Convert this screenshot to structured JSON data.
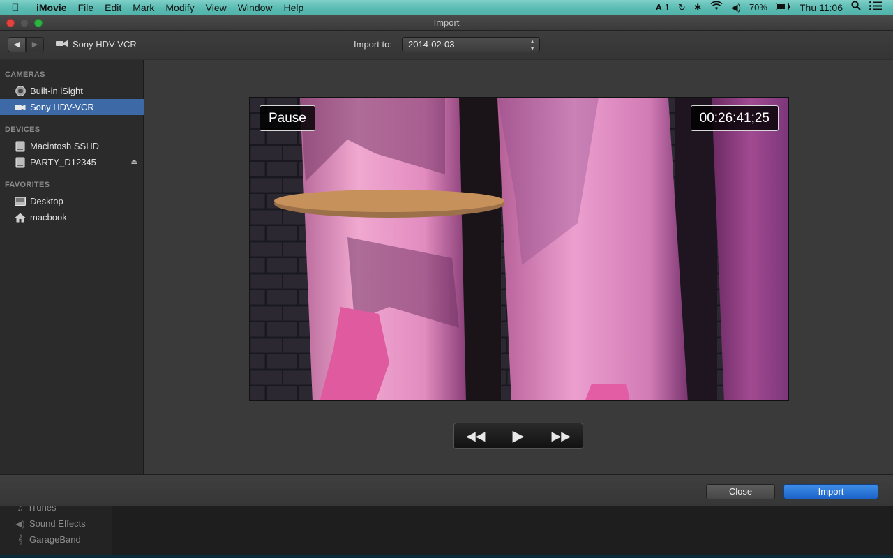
{
  "menubar": {
    "app_name": "iMovie",
    "menus": [
      "File",
      "Edit",
      "Mark",
      "Modify",
      "View",
      "Window",
      "Help"
    ],
    "status": {
      "adobe_badge": "1",
      "battery": "70%",
      "clock": "Thu 11:06"
    }
  },
  "window": {
    "title": "Import"
  },
  "toolbar": {
    "device_label": "Sony HDV-VCR",
    "import_to_label": "Import to:",
    "import_to_value": "2014-02-03"
  },
  "sidebar": {
    "sections": [
      {
        "title": "CAMERAS",
        "items": [
          {
            "label": "Built-in iSight",
            "icon": "camera-round-icon",
            "selected": false
          },
          {
            "label": "Sony HDV-VCR",
            "icon": "video-camera-icon",
            "selected": true
          }
        ]
      },
      {
        "title": "DEVICES",
        "items": [
          {
            "label": "Macintosh SSHD",
            "icon": "hard-drive-icon",
            "selected": false
          },
          {
            "label": "PARTY_D12345",
            "icon": "hard-drive-icon",
            "selected": false,
            "eject": true
          }
        ]
      },
      {
        "title": "FAVORITES",
        "items": [
          {
            "label": "Desktop",
            "icon": "desktop-icon",
            "selected": false
          },
          {
            "label": "macbook",
            "icon": "home-icon",
            "selected": false
          }
        ]
      }
    ]
  },
  "viewer": {
    "status_overlay": "Pause",
    "timecode": "00:26:41;25"
  },
  "transport": {
    "rewind_icon": "rewind-icon",
    "play_icon": "play-icon",
    "fast_forward_icon": "fast-forward-icon"
  },
  "footer": {
    "close_label": "Close",
    "import_label": "Import"
  },
  "background_library": {
    "items": [
      {
        "label": "iTunes",
        "icon": "music-note-icon"
      },
      {
        "label": "Sound Effects",
        "icon": "speaker-icon"
      },
      {
        "label": "GarageBand",
        "icon": "guitar-icon"
      }
    ]
  },
  "colors": {
    "selection": "#3d6aa6",
    "import_button": "#1c63c8",
    "menubar": "#5cbdb4"
  }
}
